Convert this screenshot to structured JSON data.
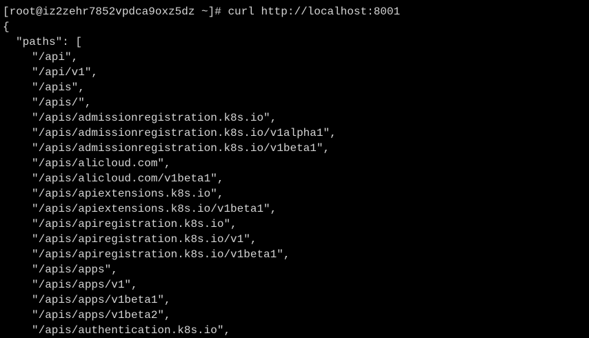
{
  "terminal": {
    "prompt": "[root@iz2zehr7852vpdca9oxz5dz ~]# ",
    "command": "curl http://localhost:8001",
    "open_brace": "{",
    "paths_key": "\"paths\": [",
    "paths": [
      "\"/api\",",
      "\"/api/v1\",",
      "\"/apis\",",
      "\"/apis/\",",
      "\"/apis/admissionregistration.k8s.io\",",
      "\"/apis/admissionregistration.k8s.io/v1alpha1\",",
      "\"/apis/admissionregistration.k8s.io/v1beta1\",",
      "\"/apis/alicloud.com\",",
      "\"/apis/alicloud.com/v1beta1\",",
      "\"/apis/apiextensions.k8s.io\",",
      "\"/apis/apiextensions.k8s.io/v1beta1\",",
      "\"/apis/apiregistration.k8s.io\",",
      "\"/apis/apiregistration.k8s.io/v1\",",
      "\"/apis/apiregistration.k8s.io/v1beta1\",",
      "\"/apis/apps\",",
      "\"/apis/apps/v1\",",
      "\"/apis/apps/v1beta1\",",
      "\"/apis/apps/v1beta2\",",
      "\"/apis/authentication.k8s.io\","
    ]
  }
}
